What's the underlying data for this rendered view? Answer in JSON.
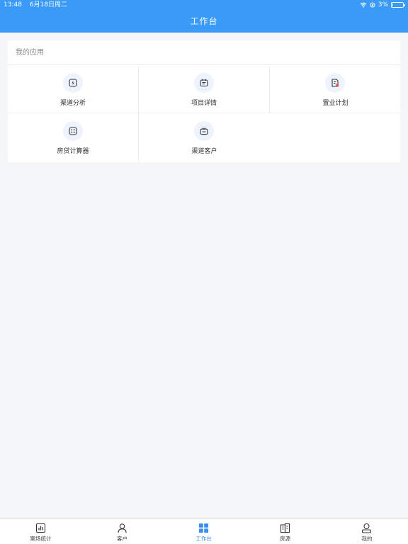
{
  "status": {
    "time": "13:48",
    "date": "6月18日周二",
    "battery": "3%",
    "battery_level": 0.03
  },
  "header": {
    "title": "工作台"
  },
  "apps": {
    "section_title": "我的应用",
    "items": [
      {
        "label": "渠道分析",
        "icon": "lightning-icon"
      },
      {
        "label": "项目详情",
        "icon": "calendar-icon"
      },
      {
        "label": "置业计划",
        "icon": "document-edit-icon"
      },
      {
        "label": "房贷计算器",
        "icon": "calculator-icon"
      },
      {
        "label": "渠道客户",
        "icon": "customer-card-icon"
      }
    ]
  },
  "tabbar": {
    "items": [
      {
        "label": "案场统计",
        "icon": "bar-chart-icon"
      },
      {
        "label": "客户",
        "icon": "person-icon"
      },
      {
        "label": "工作台",
        "icon": "grid-icon",
        "active": true
      },
      {
        "label": "房源",
        "icon": "building-icon"
      },
      {
        "label": "我的",
        "icon": "profile-icon"
      }
    ]
  },
  "colors": {
    "primary": "#3a9af8",
    "active_tab": "#3a8ef0",
    "background": "#f5f6f8",
    "icon_bg": "#eef3fd"
  }
}
